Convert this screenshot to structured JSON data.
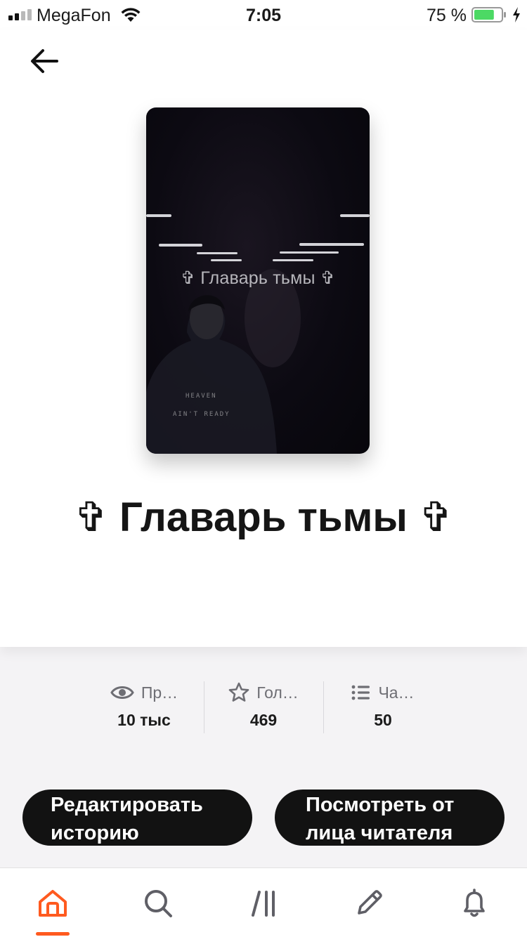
{
  "status_bar": {
    "carrier": "MegaFon",
    "time": "7:05",
    "battery_percent": "75 %",
    "battery_level": 0.75,
    "signal_bars_active": 2,
    "signal_bars_total": 4
  },
  "colors": {
    "accent": "#ff5a1f",
    "battery_fill": "#4cd964",
    "button_bg": "#121212"
  },
  "story": {
    "cover_title": "Главарь тьмы",
    "cover_shirt_line1": "HEAVEN",
    "cover_shirt_line2": "AIN'T READY",
    "title": "✞ Главарь тьмы ✞"
  },
  "stats": [
    {
      "icon": "eye-icon",
      "label": "Пр…",
      "value": "10 тыс"
    },
    {
      "icon": "star-icon",
      "label": "Гол…",
      "value": "469"
    },
    {
      "icon": "list-icon",
      "label": "Ча…",
      "value": "50"
    }
  ],
  "buttons": {
    "edit_line1": "Редактировать",
    "edit_line2": "историю",
    "reader_line1": "Посмотреть от",
    "reader_line2": "лица читателя"
  },
  "tab_bar": {
    "tabs": [
      "home-icon",
      "search-icon",
      "library-icon",
      "write-icon",
      "bell-icon"
    ],
    "active_index": 0
  }
}
